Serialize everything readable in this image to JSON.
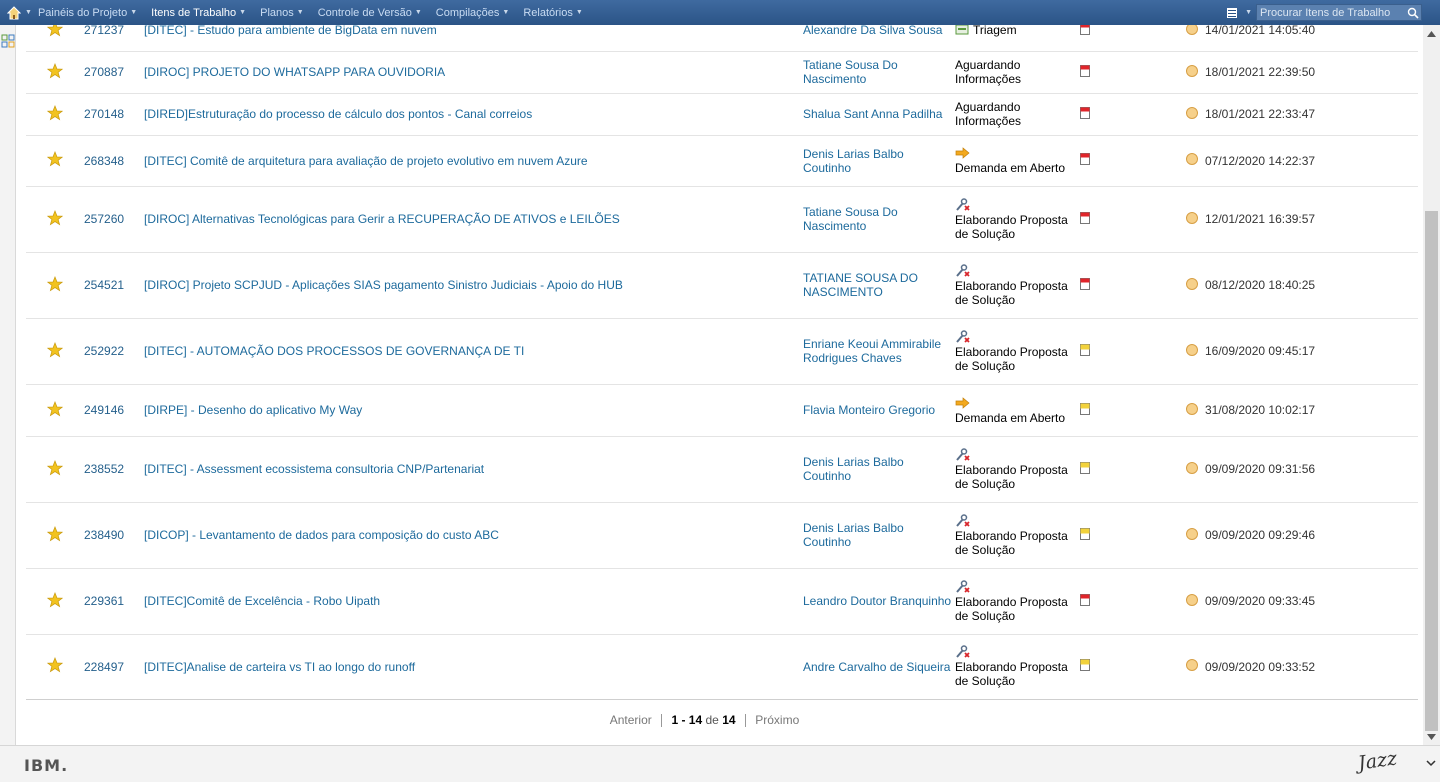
{
  "nav": {
    "items": [
      {
        "label": "Painéis do Projeto",
        "active": false
      },
      {
        "label": "Itens de Trabalho",
        "active": true
      },
      {
        "label": "Planos",
        "active": false
      },
      {
        "label": "Controle de Versão",
        "active": false
      },
      {
        "label": "Compilações",
        "active": false
      },
      {
        "label": "Relatórios",
        "active": false
      }
    ],
    "search_placeholder": "Procurar Itens de Trabalho"
  },
  "rows": [
    {
      "id": "271237",
      "summary": "[DITEC] - Estudo para ambiente de BigData em nuvem",
      "owner": "Alexandre Da Silva Sousa",
      "status": "Triagem",
      "status_icon": "triage-icon",
      "priority": "high",
      "date": "14/01/2021 14:05:40"
    },
    {
      "id": "270887",
      "summary": "[DIROC] PROJETO DO WHATSAPP PARA OUVIDORIA",
      "owner": "Tatiane Sousa Do Nascimento",
      "status": "Aguardando Informações",
      "status_icon": "",
      "priority": "high",
      "date": "18/01/2021 22:39:50"
    },
    {
      "id": "270148",
      "summary": "[DIRED]Estruturação do processo de cálculo dos pontos - Canal correios",
      "owner": "Shalua Sant Anna Padilha",
      "status": "Aguardando Informações",
      "status_icon": "",
      "priority": "high",
      "date": "18/01/2021 22:33:47"
    },
    {
      "id": "268348",
      "summary": "[DITEC] Comitê de arquitetura para avaliação de projeto evolutivo em nuvem Azure",
      "owner": "Denis Larias Balbo Coutinho",
      "status": "Demanda em Aberto",
      "status_icon": "arrow-right-icon",
      "priority": "high",
      "date": "07/12/2020 14:22:37"
    },
    {
      "id": "257260",
      "summary": "[DIROC] Alternativas Tecnológicas para Gerir a RECUPERAÇÃO DE ATIVOS e LEILÕES",
      "owner": "Tatiane Sousa Do Nascimento",
      "status": "Elaborando Proposta de Solução",
      "status_icon": "wrench-icon",
      "priority": "high",
      "date": "12/01/2021 16:39:57"
    },
    {
      "id": "254521",
      "summary": "[DIROC] Projeto SCPJUD - Aplicações SIAS pagamento Sinistro Judiciais - Apoio do HUB",
      "owner": "TATIANE SOUSA DO NASCIMENTO",
      "status": "Elaborando Proposta de Solução",
      "status_icon": "wrench-icon",
      "priority": "high",
      "date": "08/12/2020 18:40:25"
    },
    {
      "id": "252922",
      "summary": "[DITEC] - AUTOMAÇÃO DOS PROCESSOS DE GOVERNANÇA DE TI",
      "owner": "Enriane Keoui Ammirabile Rodrigues Chaves",
      "status": "Elaborando Proposta de Solução",
      "status_icon": "wrench-icon",
      "priority": "medium",
      "date": "16/09/2020 09:45:17"
    },
    {
      "id": "249146",
      "summary": "[DIRPE] - Desenho do aplicativo My Way",
      "owner": "Flavia Monteiro Gregorio",
      "status": "Demanda em Aberto",
      "status_icon": "arrow-right-icon",
      "priority": "medium",
      "date": "31/08/2020 10:02:17"
    },
    {
      "id": "238552",
      "summary": "[DITEC] - Assessment ecossistema consultoria CNP/Partenariat",
      "owner": "Denis Larias Balbo Coutinho",
      "status": "Elaborando Proposta de Solução",
      "status_icon": "wrench-icon",
      "priority": "medium",
      "date": "09/09/2020 09:31:56"
    },
    {
      "id": "238490",
      "summary": "[DICOP] - Levantamento de dados para composição do custo ABC",
      "owner": "Denis Larias Balbo Coutinho",
      "status": "Elaborando Proposta de Solução",
      "status_icon": "wrench-icon",
      "priority": "medium",
      "date": "09/09/2020 09:29:46"
    },
    {
      "id": "229361",
      "summary": "[DITEC]Comitê de Excelência - Robo Uipath",
      "owner": "Leandro Doutor Branquinho",
      "status": "Elaborando Proposta de Solução",
      "status_icon": "wrench-icon",
      "priority": "high",
      "date": "09/09/2020 09:33:45"
    },
    {
      "id": "228497",
      "summary": "[DITEC]Analise de carteira vs TI ao longo do runoff",
      "owner": "Andre Carvalho de Siqueira",
      "status": "Elaborando Proposta de Solução",
      "status_icon": "wrench-icon",
      "priority": "medium",
      "date": "09/09/2020 09:33:52"
    }
  ],
  "pager": {
    "prev": "Anterior",
    "range": "1 - 14",
    "of": "de",
    "total": "14",
    "next": "Próximo"
  },
  "footer": {
    "left_logo": "IBM.",
    "right_logo": "Jazz"
  },
  "colors": {
    "nav_bg": "#2b5486",
    "link": "#1d6a9c",
    "flag_high": "#e0252b",
    "flag_medium": "#f2d23c",
    "severity_dot": "#f6d08a"
  }
}
